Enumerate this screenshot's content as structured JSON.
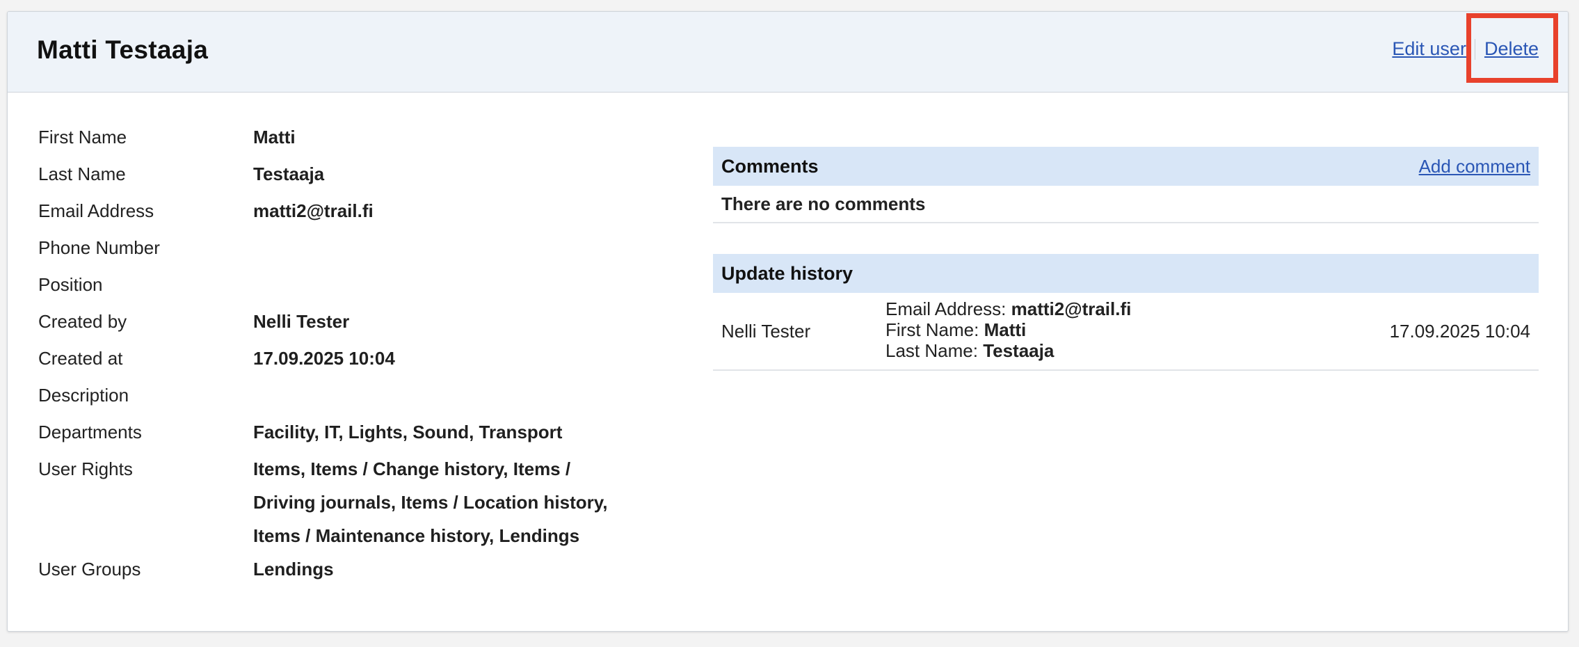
{
  "header": {
    "title": "Matti Testaaja",
    "edit_label": "Edit user",
    "delete_label": "Delete"
  },
  "details": [
    {
      "label": "First Name",
      "value": "Matti"
    },
    {
      "label": "Last Name",
      "value": "Testaaja"
    },
    {
      "label": "Email Address",
      "value": "matti2@trail.fi"
    },
    {
      "label": "Phone Number",
      "value": ""
    },
    {
      "label": "Position",
      "value": ""
    },
    {
      "label": "Created by",
      "value": "Nelli Tester"
    },
    {
      "label": "Created at",
      "value": "17.09.2025 10:04"
    },
    {
      "label": "Description",
      "value": ""
    },
    {
      "label": "Departments",
      "value": "Facility, IT, Lights, Sound, Transport"
    },
    {
      "label": "User Rights",
      "value_lines": [
        "Items, Items / Change history, Items /",
        "Driving journals, Items / Location history,",
        "Items / Maintenance history, Lendings"
      ]
    },
    {
      "label": "User Groups",
      "value": "Lendings"
    }
  ],
  "comments": {
    "title": "Comments",
    "add_label": "Add comment",
    "empty_text": "There are no comments"
  },
  "history": {
    "title": "Update history",
    "entries": [
      {
        "user": "Nelli Tester",
        "changes": [
          {
            "field": "Email Address:",
            "value": "matti2@trail.fi"
          },
          {
            "field": "First Name:",
            "value": "Matti"
          },
          {
            "field": "Last Name:",
            "value": "Testaaja"
          }
        ],
        "date": "17.09.2025 10:04"
      }
    ]
  },
  "colors": {
    "link": "#2a56b5",
    "panel_header": "#d8e6f7",
    "card_header": "#eef3f9",
    "highlight": "#e8412c"
  }
}
